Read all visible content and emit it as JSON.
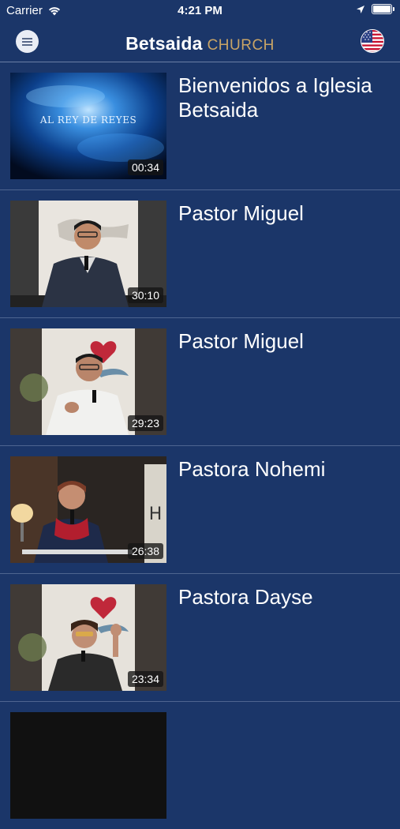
{
  "status_bar": {
    "carrier": "Carrier",
    "time": "4:21 PM"
  },
  "header": {
    "brand_bold": "Betsaida",
    "brand_light": "CHURCH",
    "menu_icon": "hamburger-menu-icon",
    "language_icon": "us-flag-icon"
  },
  "videos": [
    {
      "title": "Bienvenidos a Iglesia Betsaida",
      "duration": "00:34",
      "thumb_text": "AL REY DE REYES"
    },
    {
      "title": "Pastor Miguel",
      "duration": "30:10"
    },
    {
      "title": "Pastor Miguel",
      "duration": "29:23"
    },
    {
      "title": "Pastora Nohemi",
      "duration": "26:38"
    },
    {
      "title": "Pastora Dayse",
      "duration": "23:34"
    }
  ],
  "colors": {
    "background": "#1b3669",
    "brand_accent": "#c9a466",
    "divider": "#4e6590"
  }
}
